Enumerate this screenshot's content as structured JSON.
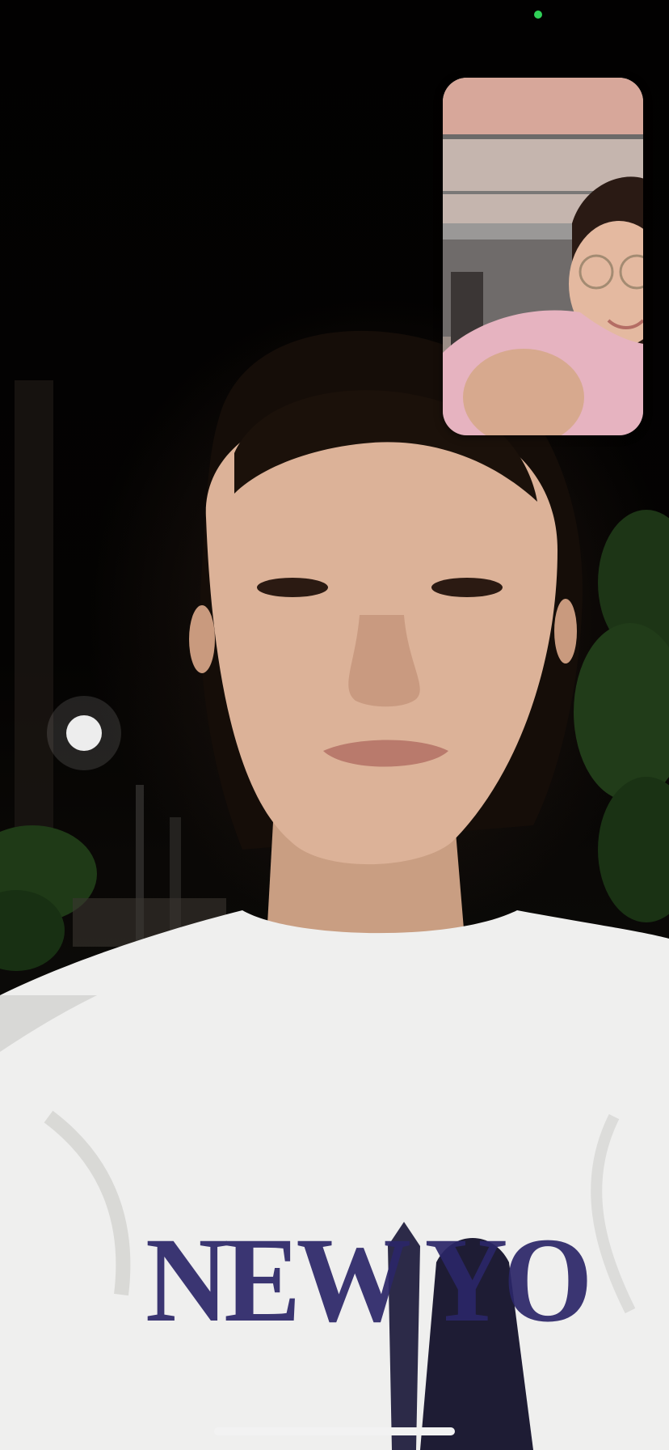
{
  "call": {
    "type": "video-call",
    "remote_feed": "remote-participant-video",
    "self_feed": "local-camera-preview"
  },
  "shirt_print": {
    "text": "NEW YO"
  },
  "status": {
    "camera_indicator_color": "#30d158"
  },
  "colors": {
    "background": "#050303",
    "home_indicator": "#f2f2f2"
  }
}
